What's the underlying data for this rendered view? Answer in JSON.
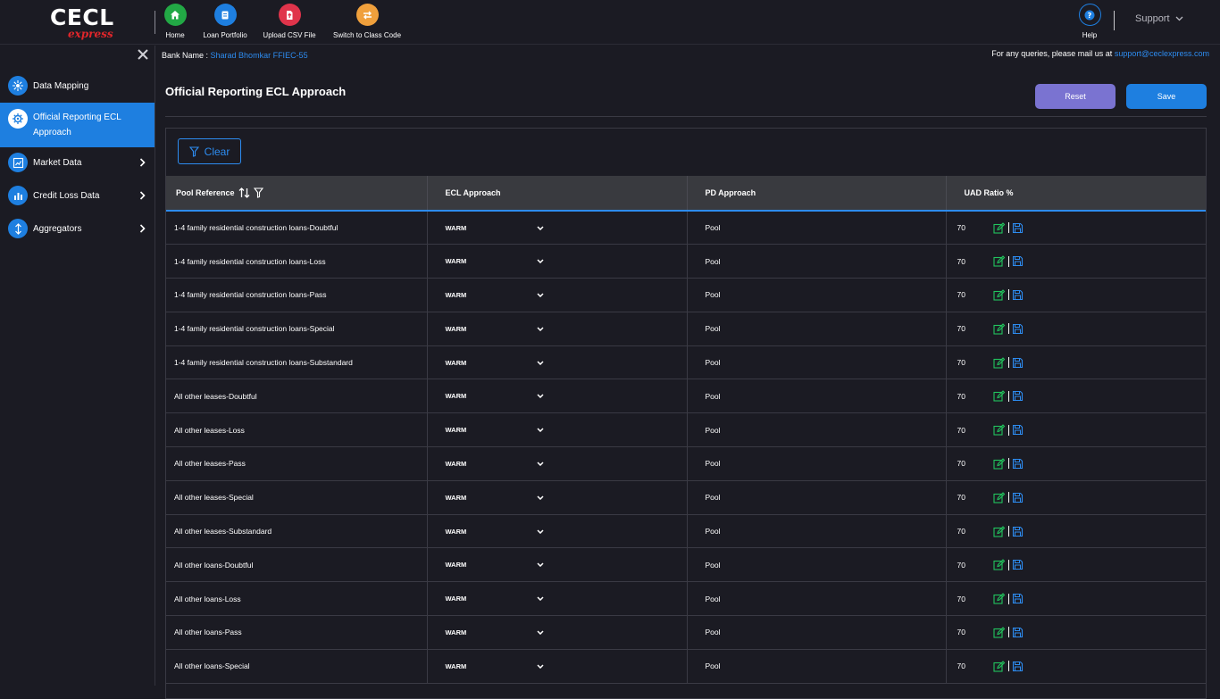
{
  "header": {
    "logo_main": "CECL",
    "logo_sub": "express",
    "nav": [
      {
        "label": "Home",
        "icon": "home-icon",
        "color": "#22a845"
      },
      {
        "label": "Loan Portfolio",
        "icon": "portfolio-icon",
        "color": "#1e7fe0"
      },
      {
        "label": "Upload CSV File",
        "icon": "upload-file-icon",
        "color": "#e0344b"
      },
      {
        "label": "Switch to Class Code",
        "icon": "switch-icon",
        "color": "#f0a03c"
      }
    ],
    "help_label": "Help",
    "support_label": "Support"
  },
  "sidebar": {
    "items": [
      {
        "label": "Data Mapping",
        "icon": "data-mapping-icon",
        "has_children": false,
        "active": false
      },
      {
        "label": "Official Reporting ECL Approach",
        "icon": "settings-icon",
        "has_children": false,
        "active": true
      },
      {
        "label": "Market Data",
        "icon": "market-data-icon",
        "has_children": true,
        "active": false
      },
      {
        "label": "Credit Loss Data",
        "icon": "credit-loss-icon",
        "has_children": true,
        "active": false
      },
      {
        "label": "Aggregators",
        "icon": "aggregators-icon",
        "has_children": true,
        "active": false
      }
    ]
  },
  "main": {
    "bank_label": "Bank Name : ",
    "bank_value": "Sharad Bhomkar FFIEC-55",
    "query_label": "For any queries, please mail us at ",
    "query_email": "support@ceclexpress.com",
    "title": "Official Reporting ECL Approach",
    "reset_label": "Reset",
    "save_label": "Save",
    "clear_label": "Clear",
    "table": {
      "columns": [
        "Pool Reference",
        "ECL Approach",
        "PD Approach",
        "UAD Ratio %"
      ],
      "rows": [
        {
          "pool": "1-4 family residential construction loans-Doubtful",
          "ecl": "WARM",
          "pd": "Pool",
          "uad": "70"
        },
        {
          "pool": "1-4 family residential construction loans-Loss",
          "ecl": "WARM",
          "pd": "Pool",
          "uad": "70"
        },
        {
          "pool": "1-4 family residential construction loans-Pass",
          "ecl": "WARM",
          "pd": "Pool",
          "uad": "70"
        },
        {
          "pool": "1-4 family residential construction loans-Special",
          "ecl": "WARM",
          "pd": "Pool",
          "uad": "70"
        },
        {
          "pool": "1-4 family residential construction loans-Substandard",
          "ecl": "WARM",
          "pd": "Pool",
          "uad": "70"
        },
        {
          "pool": "All other leases-Doubtful",
          "ecl": "WARM",
          "pd": "Pool",
          "uad": "70"
        },
        {
          "pool": "All other leases-Loss",
          "ecl": "WARM",
          "pd": "Pool",
          "uad": "70"
        },
        {
          "pool": "All other leases-Pass",
          "ecl": "WARM",
          "pd": "Pool",
          "uad": "70"
        },
        {
          "pool": "All other leases-Special",
          "ecl": "WARM",
          "pd": "Pool",
          "uad": "70"
        },
        {
          "pool": "All other leases-Substandard",
          "ecl": "WARM",
          "pd": "Pool",
          "uad": "70"
        },
        {
          "pool": "All other loans-Doubtful",
          "ecl": "WARM",
          "pd": "Pool",
          "uad": "70"
        },
        {
          "pool": "All other loans-Loss",
          "ecl": "WARM",
          "pd": "Pool",
          "uad": "70"
        },
        {
          "pool": "All other loans-Pass",
          "ecl": "WARM",
          "pd": "Pool",
          "uad": "70"
        },
        {
          "pool": "All other loans-Special",
          "ecl": "WARM",
          "pd": "Pool",
          "uad": "70"
        }
      ]
    }
  },
  "colors": {
    "accent": "#1e7fe0",
    "edit_icon": "#22c55e",
    "save_icon": "#2d8cf0",
    "reset_button": "#7a73d1"
  }
}
